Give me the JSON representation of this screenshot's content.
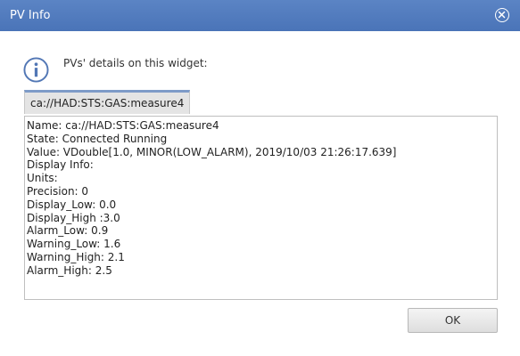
{
  "window": {
    "title": "PV Info"
  },
  "header": {
    "icon": "info-icon",
    "text": "PVs' details on this widget:"
  },
  "tabs": [
    {
      "label": "ca://HAD:STS:GAS:measure4",
      "selected": true
    }
  ],
  "details": {
    "lines": [
      "Name: ca://HAD:STS:GAS:measure4",
      "State: Connected Running",
      "Value: VDouble[1.0, MINOR(LOW_ALARM), 2019/10/03 21:26:17.639]",
      "Display Info:",
      "Units:",
      "Precision: 0",
      "Display_Low: 0.0",
      "Display_High :3.0",
      "Alarm_Low: 0.9",
      "Warning_Low: 1.6",
      "Warning_High: 2.1",
      "Alarm_High: 2.5"
    ]
  },
  "buttons": {
    "ok_label": "OK"
  },
  "colors": {
    "titlebar": "#4f78bc",
    "info_icon": "#5277b5",
    "tab_accent": "#7e9bc8"
  }
}
